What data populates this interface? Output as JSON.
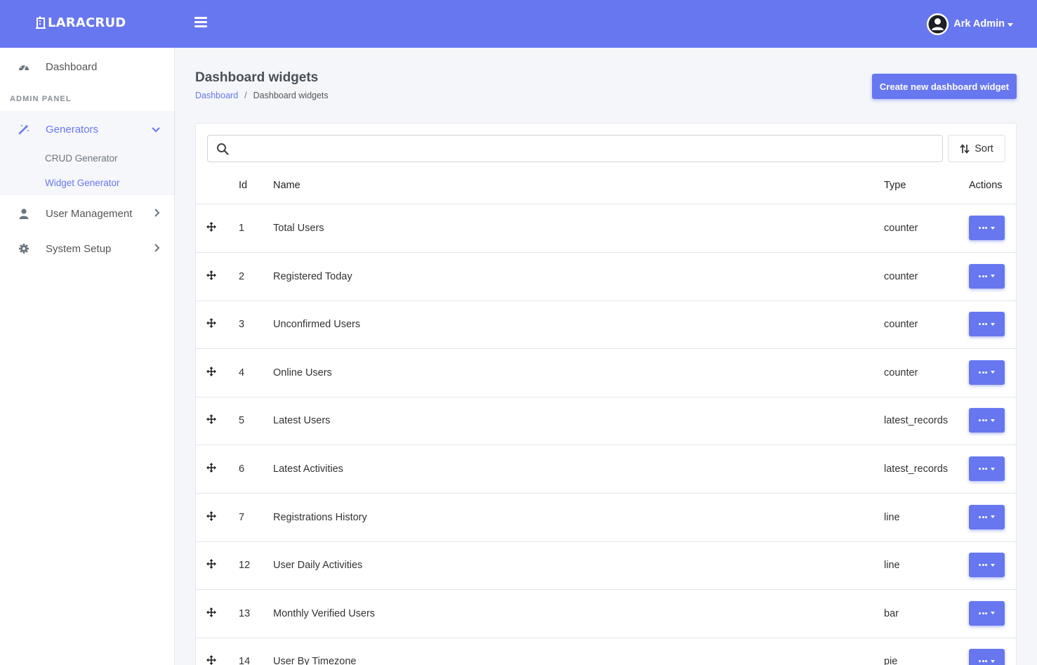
{
  "brand": {
    "name": "LARACRUD"
  },
  "header": {
    "user_name": "Ark Admin"
  },
  "sidebar": {
    "dashboard": "Dashboard",
    "section_title": "ADMIN PANEL",
    "generators": "Generators",
    "crud_generator": "CRUD Generator",
    "widget_generator": "Widget Generator",
    "user_management": "User Management",
    "system_setup": "System Setup"
  },
  "page": {
    "title": "Dashboard widgets",
    "breadcrumb_home": "Dashboard",
    "breadcrumb_current": "Dashboard widgets",
    "create_button": "Create new dashboard widget"
  },
  "search": {
    "placeholder": ""
  },
  "sort_label": "Sort",
  "table": {
    "headers": {
      "id": "Id",
      "name": "Name",
      "type": "Type",
      "actions": "Actions"
    },
    "rows": [
      {
        "id": "1",
        "name": "Total Users",
        "type": "counter"
      },
      {
        "id": "2",
        "name": "Registered Today",
        "type": "counter"
      },
      {
        "id": "3",
        "name": "Unconfirmed Users",
        "type": "counter"
      },
      {
        "id": "4",
        "name": "Online Users",
        "type": "counter"
      },
      {
        "id": "5",
        "name": "Latest Users",
        "type": "latest_records"
      },
      {
        "id": "6",
        "name": "Latest Activities",
        "type": "latest_records"
      },
      {
        "id": "7",
        "name": "Registrations History",
        "type": "line"
      },
      {
        "id": "12",
        "name": "User Daily Activities",
        "type": "line"
      },
      {
        "id": "13",
        "name": "Monthly Verified Users",
        "type": "bar"
      },
      {
        "id": "14",
        "name": "User By Timezone",
        "type": "pie"
      }
    ]
  },
  "colors": {
    "primary": "#6777ef",
    "background": "#f4f6f9"
  }
}
